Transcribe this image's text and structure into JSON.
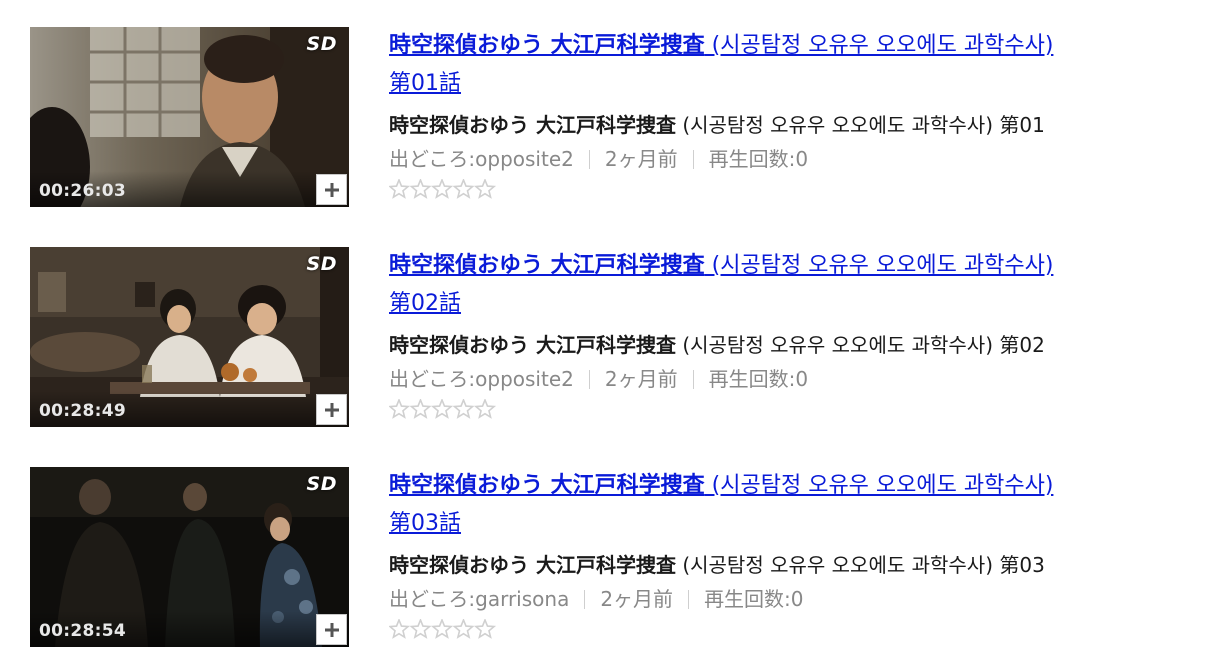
{
  "videos": [
    {
      "quality_badge": "SD",
      "duration": "00:26:03",
      "title_jp": "時空探偵おゆう 大江戸科学捜査",
      "title_ko": " (시공탐정 오유우 오오에도 과학수사)",
      "title_ep": "第01話",
      "subtitle_jp": "時空探偵おゆう 大江戸科学捜査",
      "subtitle_rest": " (시공탐정 오유우 오오에도 과학수사) 第01",
      "source": "出どころ:opposite2",
      "posted": "2ヶ月前",
      "views": "再生回数:0",
      "rating": 0
    },
    {
      "quality_badge": "SD",
      "duration": "00:28:49",
      "title_jp": "時空探偵おゆう 大江戸科学捜査",
      "title_ko": " (시공탐정 오유우 오오에도 과학수사)",
      "title_ep": "第02話",
      "subtitle_jp": "時空探偵おゆう 大江戸科学捜査",
      "subtitle_rest": " (시공탐정 오유우 오오에도 과학수사) 第02",
      "source": "出どころ:opposite2",
      "posted": "2ヶ月前",
      "views": "再生回数:0",
      "rating": 0
    },
    {
      "quality_badge": "SD",
      "duration": "00:28:54",
      "title_jp": "時空探偵おゆう 大江戸科学捜査",
      "title_ko": " (시공탐정 오유우 오오에도 과학수사)",
      "title_ep": "第03話",
      "subtitle_jp": "時空探偵おゆう 大江戸科学捜査",
      "subtitle_rest": " (시공탐정 오유우 오오에도 과학수사) 第03",
      "source": "出どころ:garrisona",
      "posted": "2ヶ月前",
      "views": "再生回数:0",
      "rating": 0
    }
  ],
  "colors": {
    "title_link": "#0a1bd8",
    "subtitle_text": "#1a1a1a",
    "meta_text": "#888888",
    "empty_star": "#d0d0d0"
  },
  "icons": {
    "add": "plus-icon",
    "rating": "star-icon"
  }
}
